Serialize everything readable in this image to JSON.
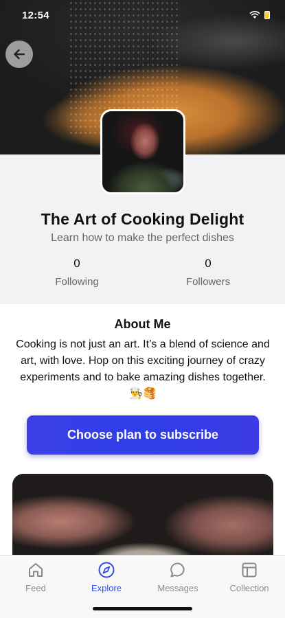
{
  "status_bar": {
    "time": "12:54"
  },
  "profile": {
    "title": "The Art of Cooking Delight",
    "subtitle": "Learn how to make the perfect dishes",
    "following_count": "0",
    "following_label": "Following",
    "followers_count": "0",
    "followers_label": "Followers"
  },
  "about": {
    "title": "About Me",
    "text": "Cooking is not just an art. It’s a blend of science and art, with love. Hop on this exciting journey of crazy experiments and to bake amazing dishes together. 👨‍🍳🥞"
  },
  "subscribe_label": "Choose plan to subscribe",
  "tabs": [
    {
      "label": "Feed",
      "icon": "home-icon",
      "active": false
    },
    {
      "label": "Explore",
      "icon": "compass-icon",
      "active": true
    },
    {
      "label": "Messages",
      "icon": "chat-bubble-icon",
      "active": false
    },
    {
      "label": "Collection",
      "icon": "collection-icon",
      "active": false
    }
  ],
  "colors": {
    "accent": "#2c4de0",
    "button_gradient_start": "#3b3fe6",
    "button_gradient_end": "#3d3be4",
    "profile_background": "#f2f2f4",
    "tab_inactive": "#888888"
  }
}
